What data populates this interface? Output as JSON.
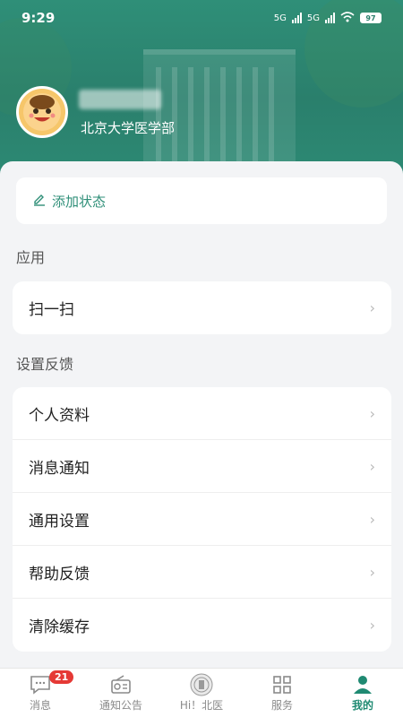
{
  "status_bar": {
    "time": "9:29",
    "network1": "5G",
    "network2": "5G",
    "battery": "97"
  },
  "profile": {
    "school": "北京大学医学部"
  },
  "status_card": {
    "label": "添加状态"
  },
  "sections": {
    "apps": {
      "title": "应用",
      "items": [
        {
          "label": "扫一扫"
        }
      ]
    },
    "settings": {
      "title": "设置反馈",
      "items": [
        {
          "label": "个人资料"
        },
        {
          "label": "消息通知"
        },
        {
          "label": "通用设置"
        },
        {
          "label": "帮助反馈"
        },
        {
          "label": "清除缓存"
        }
      ]
    }
  },
  "tabbar": {
    "items": [
      {
        "label": "消息",
        "badge": "21",
        "icon": "message-icon"
      },
      {
        "label": "通知公告",
        "icon": "radio-icon"
      },
      {
        "label": "Hi！北医",
        "icon": "emblem-icon"
      },
      {
        "label": "服务",
        "icon": "grid-icon"
      },
      {
        "label": "我的",
        "icon": "person-icon"
      }
    ],
    "active": "我的",
    "accent": "#1f8a72"
  },
  "colors": {
    "brand": "#2f8f78",
    "badge": "#e53935"
  }
}
